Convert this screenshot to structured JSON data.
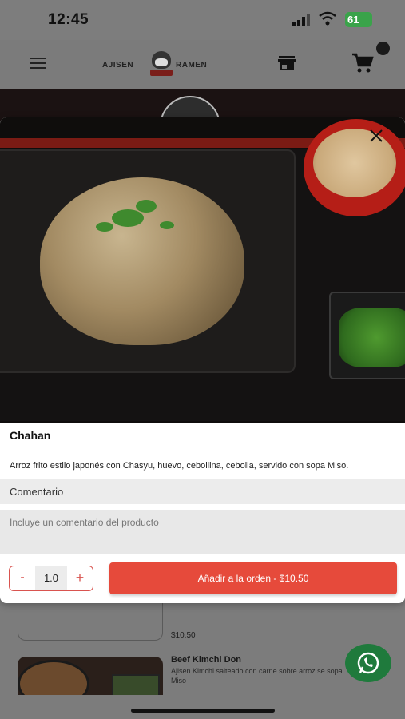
{
  "status_bar": {
    "time": "12:45",
    "battery": "61"
  },
  "header": {
    "logo_left": "AJISEN",
    "logo_right": "RAMEN"
  },
  "modal": {
    "title": "Chahan",
    "description": "Arroz frito estilo japonés con Chasyu, huevo, cebollina, cebolla, servido con sopa Miso.",
    "comment_label": "Comentario",
    "comment_placeholder": "Incluye un comentario del producto",
    "quantity": "1.0",
    "minus_label": "-",
    "plus_label": "+",
    "add_button_label": "Añadir a la orden - $10.50",
    "close_icon": "close-icon"
  },
  "background_list": {
    "previous_price": "$10.50",
    "next_item_title": "Beef Kimchi Don",
    "next_item_desc": "Ajisen Kimchi salteado con carne sobre arroz se sopa Miso"
  },
  "colors": {
    "accent": "#e64a3b",
    "whatsapp": "#25d366"
  }
}
